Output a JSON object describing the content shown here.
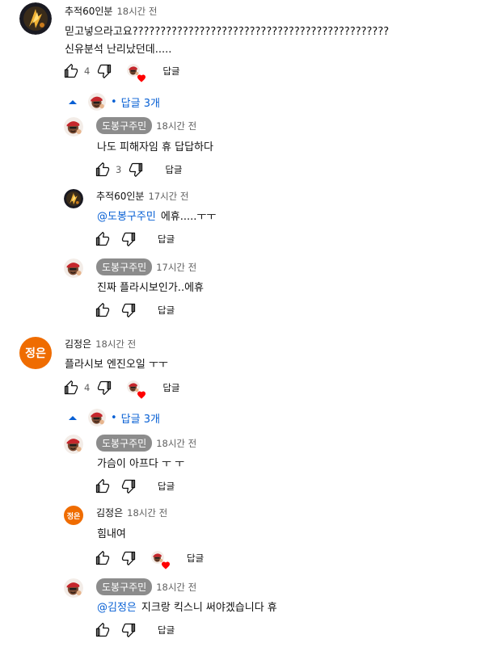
{
  "labels": {
    "reply": "답글"
  },
  "threads": [
    {
      "author": "추적60인분",
      "time": "18시간 전",
      "lines": [
        "믿고넣으라고요??????????????????????????????????????????????",
        "신유분석  난리났던데....."
      ],
      "likes": "4",
      "hearted": true,
      "replies_toggle": "답글 3개",
      "replies": [
        {
          "author": "도봉구주민",
          "time": "18시간 전",
          "text": "나도 피해자임 휴 답답하다",
          "likes": "3"
        },
        {
          "author": "추적60인분",
          "time": "17시간 전",
          "mention": "@도봉구주민",
          "text": "에휴.....ㅜㅜ"
        },
        {
          "author": "도봉구주민",
          "time": "17시간 전",
          "text": "진짜 플라시보인가..에휴"
        }
      ]
    },
    {
      "author": "김정은",
      "avatar_text": "정은",
      "time": "18시간 전",
      "lines": [
        "플라시보 엔진오일 ㅜㅜ"
      ],
      "likes": "4",
      "hearted": true,
      "replies_toggle": "답글 3개",
      "replies": [
        {
          "author": "도봉구주민",
          "time": "18시간 전",
          "text": "가슴이 아프다 ㅜ ㅜ"
        },
        {
          "author": "김정은",
          "avatar_text": "정은",
          "time": "18시간 전",
          "text": "힘내여",
          "hearted": true
        },
        {
          "author": "도봉구주민",
          "time": "18시간 전",
          "mention": "@김정은",
          "text": "지크랑 킥스니 써야겠습니다 휴"
        }
      ]
    }
  ]
}
